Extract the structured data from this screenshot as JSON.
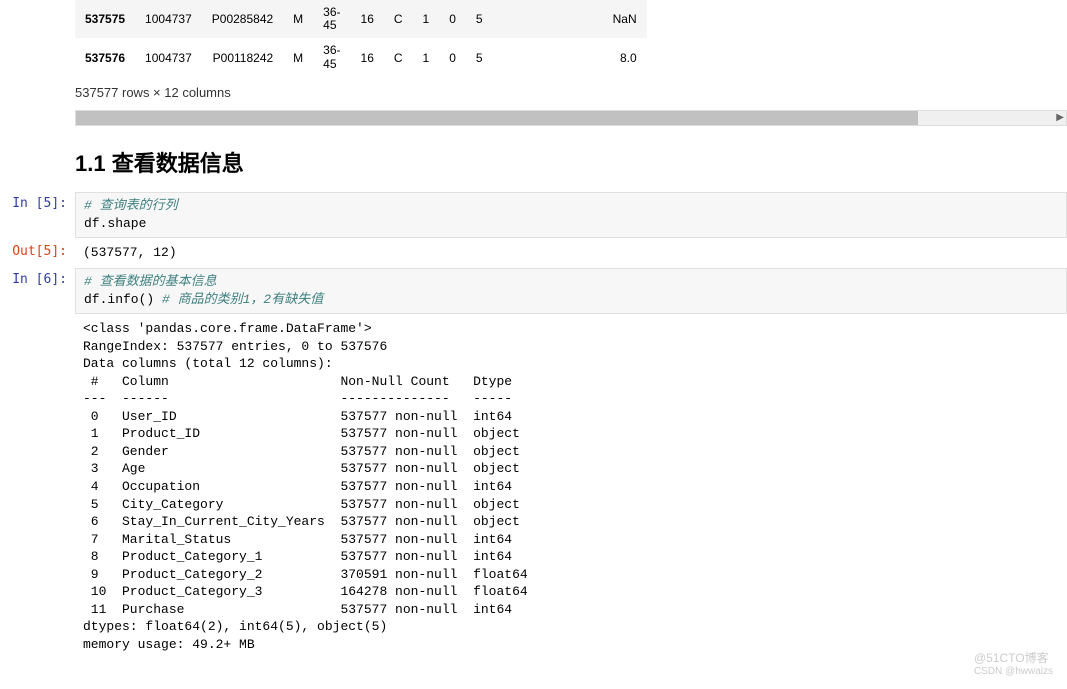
{
  "table": {
    "rows": [
      {
        "idx": "537575",
        "user_id": "1004737",
        "product_id": "P00285842",
        "gender": "M",
        "age": "36-45",
        "occupation": "16",
        "city": "C",
        "stay": "1",
        "marital": "0",
        "pc1": "5",
        "pc2": "NaN"
      },
      {
        "idx": "537576",
        "user_id": "1004737",
        "product_id": "P00118242",
        "gender": "M",
        "age": "36-45",
        "occupation": "16",
        "city": "C",
        "stay": "1",
        "marital": "0",
        "pc1": "5",
        "pc2": "8.0"
      }
    ]
  },
  "table_caption": "537577 rows × 12 columns",
  "heading": "1.1 查看数据信息",
  "cell5": {
    "prompt_in": "In  [5]:",
    "prompt_out": "Out[5]:",
    "comment": "# 查询表的行列",
    "code": "df.shape",
    "output": "(537577, 12)"
  },
  "cell6": {
    "prompt_in": "In  [6]:",
    "comment1": "# 查看数据的基本信息",
    "code": "df.info()  ",
    "comment2": "# 商品的类别1，2有缺失值",
    "output": "<class 'pandas.core.frame.DataFrame'>\nRangeIndex: 537577 entries, 0 to 537576\nData columns (total 12 columns):\n #   Column                      Non-Null Count   Dtype  \n---  ------                      --------------   -----  \n 0   User_ID                     537577 non-null  int64  \n 1   Product_ID                  537577 non-null  object \n 2   Gender                      537577 non-null  object \n 3   Age                         537577 non-null  object \n 4   Occupation                  537577 non-null  int64  \n 5   City_Category               537577 non-null  object \n 6   Stay_In_Current_City_Years  537577 non-null  object \n 7   Marital_Status              537577 non-null  int64  \n 8   Product_Category_1          537577 non-null  int64  \n 9   Product_Category_2          370591 non-null  float64\n 10  Product_Category_3          164278 non-null  float64\n 11  Purchase                    537577 non-null  int64  \ndtypes: float64(2), int64(5), object(5)\nmemory usage: 49.2+ MB"
  },
  "watermark": {
    "line1": "@51CTO博客",
    "line2": "CSDN @hwwaizs"
  }
}
